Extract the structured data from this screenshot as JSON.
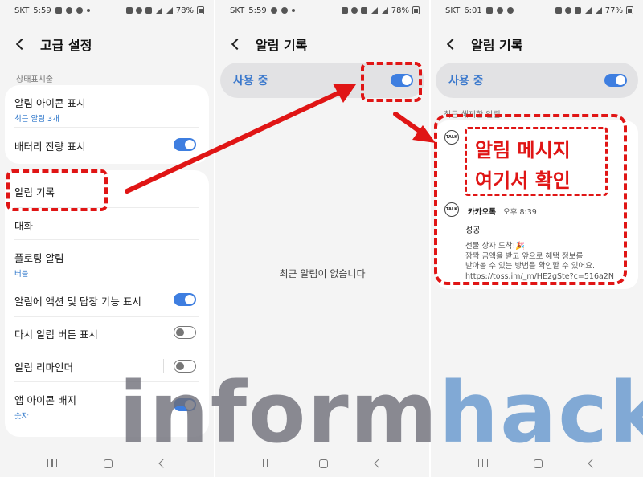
{
  "panel1": {
    "status": {
      "carrier": "SKT",
      "time": "5:59",
      "battery": "78%"
    },
    "title": "고급 설정",
    "section_label": "상태표시줄",
    "items": [
      {
        "label": "알림 아이콘 표시",
        "sub": "최근 알림 3개"
      },
      {
        "label": "배터리 잔량 표시",
        "toggle": true
      },
      {
        "label": "알림 기록"
      },
      {
        "label": "대화"
      },
      {
        "label": "플로팅 알림",
        "sub": "버블"
      },
      {
        "label": "알림에 액션 및 답장 기능 표시",
        "toggle": true
      },
      {
        "label": "다시 알림 버튼 표시",
        "toggle": false
      },
      {
        "label": "알림 리마인더",
        "toggle": false
      },
      {
        "label": "앱 아이콘 배지",
        "sub": "숫자",
        "toggle": true
      }
    ]
  },
  "panel2": {
    "status": {
      "carrier": "SKT",
      "time": "5:59",
      "battery": "78%"
    },
    "title": "알림 기록",
    "master_label": "사용 중",
    "master_on": true,
    "empty_message": "최근 알림이 없습니다"
  },
  "panel3": {
    "status": {
      "carrier": "SKT",
      "time": "6:01",
      "battery": "77%"
    },
    "title": "알림 기록",
    "master_label": "사용 중",
    "master_on": true,
    "section_label": "최근 해제한 알림",
    "notification": {
      "app_name": "카카오톡",
      "time": "오후 8:39",
      "icon_text": "TALK",
      "title": "성공",
      "lines": [
        "선물 상자 도착!🎉",
        "깜짝 금액을 받고 앞으로 혜택 정보를",
        "받아볼 수 있는 방법을 확인할 수 있어요.",
        "https://toss.im/_m/HE2gSte?c=516a2N"
      ]
    }
  },
  "annotation": {
    "callout_line1": "알림 메시지",
    "callout_line2": "여기서 확인",
    "color": "#e01515"
  },
  "watermark": {
    "part1": "inform",
    "part2": "hack"
  },
  "colors": {
    "accent": "#3e7ee0",
    "annotation": "#e01515",
    "background": "#f4f4f4"
  }
}
